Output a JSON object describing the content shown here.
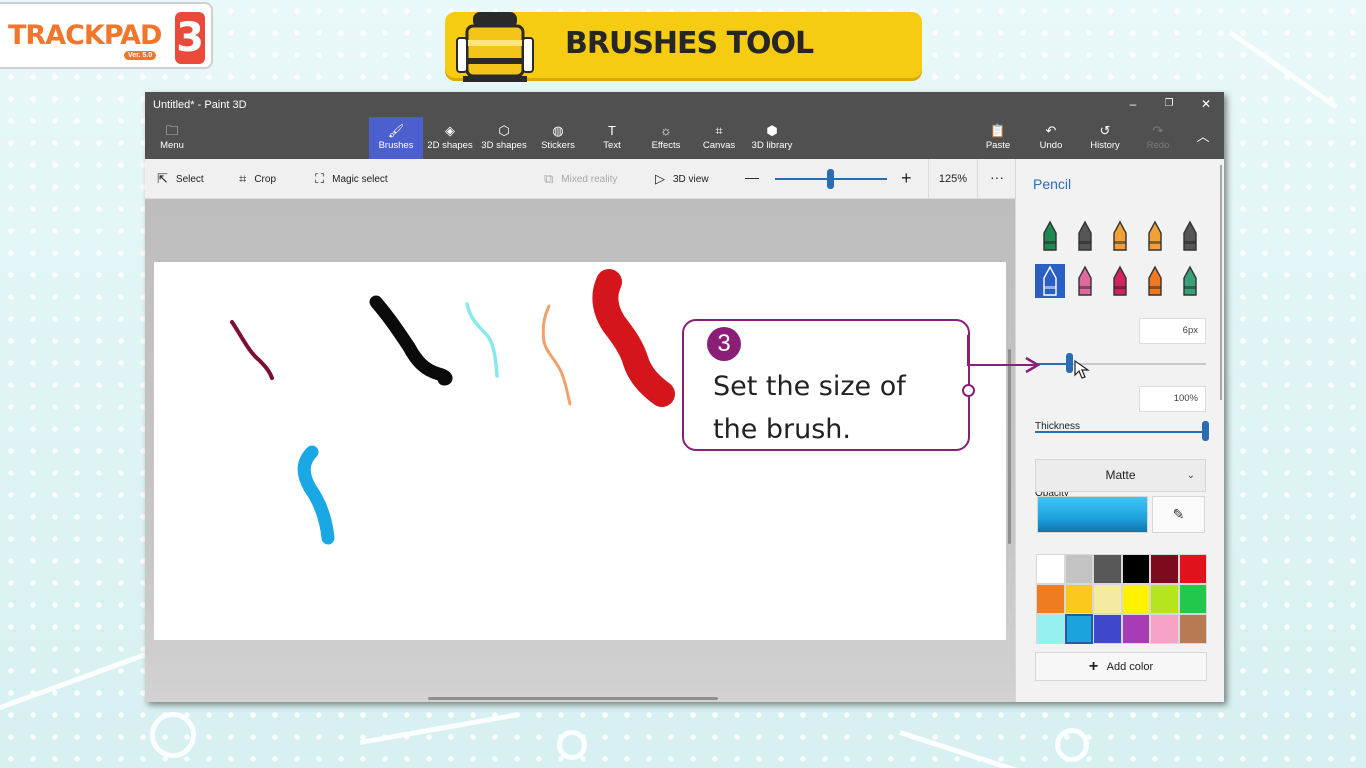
{
  "logo": {
    "text": "TRACKPAD",
    "version": "Ver. 5.0",
    "number": "3"
  },
  "banner": {
    "title": "BRUSHES TOOL",
    "icon": "brush-stand-icon"
  },
  "window": {
    "title": "Untitled* - Paint 3D",
    "controls": [
      "minimize-icon",
      "restore-icon",
      "close-icon"
    ]
  },
  "ribbon": {
    "menu": {
      "label": "Menu",
      "icon": "folder-icon"
    },
    "tabs": [
      {
        "label": "Brushes",
        "icon": "brush-icon",
        "active": true
      },
      {
        "label": "2D shapes",
        "icon": "shapes-2d-icon"
      },
      {
        "label": "3D shapes",
        "icon": "cube-icon"
      },
      {
        "label": "Stickers",
        "icon": "sticker-icon"
      },
      {
        "label": "Text",
        "icon": "text-icon"
      },
      {
        "label": "Effects",
        "icon": "sun-icon"
      },
      {
        "label": "Canvas",
        "icon": "canvas-icon"
      },
      {
        "label": "3D library",
        "icon": "library-icon"
      }
    ],
    "right": [
      {
        "label": "Paste",
        "icon": "paste-icon"
      },
      {
        "label": "Undo",
        "icon": "undo-icon"
      },
      {
        "label": "History",
        "icon": "history-icon"
      },
      {
        "label": "Redo",
        "icon": "redo-icon",
        "disabled": true
      }
    ]
  },
  "toolbar": {
    "select": "Select",
    "crop": "Crop",
    "magic_select": "Magic select",
    "mixed_reality": "Mixed reality",
    "view_3d": "3D view",
    "zoom_out": "—",
    "zoom_in": "+",
    "zoom_value": "125%",
    "zoom_level": 0.5,
    "more": "···"
  },
  "panel": {
    "title": "Pencil",
    "brushes": [
      {
        "name": "marker",
        "color": "#1e8a52"
      },
      {
        "name": "calligraphy-pen",
        "color": "#555555"
      },
      {
        "name": "oil-brush",
        "color": "#f0a035"
      },
      {
        "name": "watercolor",
        "color": "#f0a035"
      },
      {
        "name": "pixel-pen",
        "color": "#555555"
      },
      {
        "name": "pencil",
        "color": "#2b5fc4",
        "selected": true
      },
      {
        "name": "eraser",
        "color": "#e06aa0"
      },
      {
        "name": "crayon",
        "color": "#d0245a"
      },
      {
        "name": "spray-can",
        "color": "#f07820"
      },
      {
        "name": "fill",
        "color": "#3aa07a"
      }
    ],
    "thickness_label": "Thickness",
    "thickness_value": "6px",
    "thickness_level": 0.2,
    "opacity_label": "Opacity",
    "opacity_value": "100%",
    "opacity_level": 1.0,
    "finish": "Matte",
    "current_color": "#1ba3de",
    "palette": [
      "#ffffff",
      "#c3c3c3",
      "#585858",
      "#000000",
      "#7e0a20",
      "#e0121c",
      "#f07c22",
      "#fcc81c",
      "#f4eba0",
      "#fff200",
      "#b5e61d",
      "#22c84a",
      "#95f0f0",
      "#1ba3de",
      "#3f48cc",
      "#a83cb6",
      "#f6a3c7",
      "#b87a52"
    ],
    "selected_swatch": 13,
    "add_color": "Add color"
  },
  "callout": {
    "step": "3",
    "text": "Set the size of the brush."
  },
  "strokes": [
    {
      "name": "maroon-stroke",
      "color": "#7a1030"
    },
    {
      "name": "black-stroke",
      "color": "#0a0a0a"
    },
    {
      "name": "aqua-stroke",
      "color": "#8ae8ec"
    },
    {
      "name": "peach-stroke",
      "color": "#f0a068"
    },
    {
      "name": "red-stroke",
      "color": "#d4161c"
    },
    {
      "name": "blue-stroke",
      "color": "#1aa8e4"
    }
  ]
}
